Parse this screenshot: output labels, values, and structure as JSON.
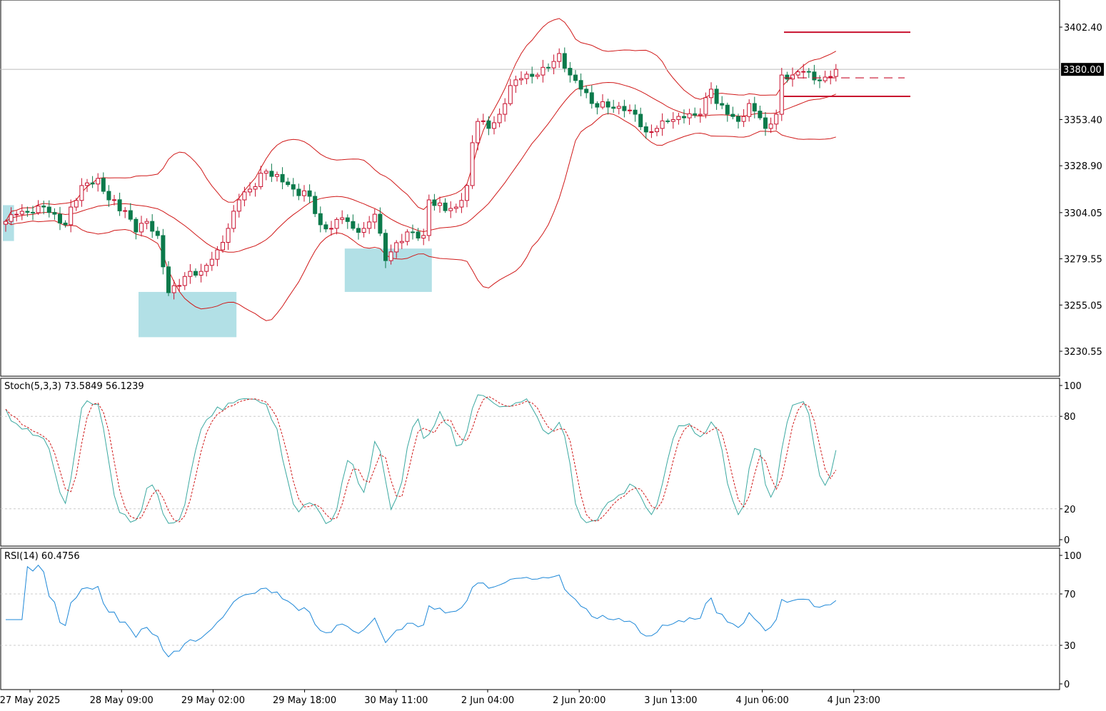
{
  "chart_data": {
    "type": "candlestick",
    "symbol_timeframe": "H1",
    "bars": 154,
    "close_path": [
      [
        0,
        3299.4
      ],
      [
        2,
        3303.2
      ],
      [
        5,
        3304.0
      ],
      [
        7,
        3307.0
      ],
      [
        9,
        3303.2
      ],
      [
        11,
        3297.6
      ],
      [
        12,
        3307.0
      ],
      [
        14,
        3318.4
      ],
      [
        17,
        3322.2
      ],
      [
        19,
        3310.8
      ],
      [
        22,
        3305.1
      ],
      [
        24,
        3293.8
      ],
      [
        26,
        3299.4
      ],
      [
        28,
        3291.9
      ],
      [
        30,
        3261.6
      ],
      [
        32,
        3265.4
      ],
      [
        34,
        3272.9
      ],
      [
        36,
        3272.9
      ],
      [
        39,
        3284.3
      ],
      [
        41,
        3295.7
      ],
      [
        43,
        3310.8
      ],
      [
        45,
        3316.5
      ],
      [
        48,
        3326.0
      ],
      [
        51,
        3320.3
      ],
      [
        53,
        3316.5
      ],
      [
        56,
        3312.7
      ],
      [
        58,
        3297.6
      ],
      [
        60,
        3295.7
      ],
      [
        62,
        3301.3
      ],
      [
        64,
        3295.7
      ],
      [
        66,
        3295.7
      ],
      [
        68,
        3303.2
      ],
      [
        70,
        3278.6
      ],
      [
        72,
        3288.1
      ],
      [
        74,
        3293.8
      ],
      [
        77,
        3291.9
      ],
      [
        78,
        3310.8
      ],
      [
        81,
        3305.1
      ],
      [
        83,
        3307.0
      ],
      [
        85,
        3318.4
      ],
      [
        86,
        3341.1
      ],
      [
        87,
        3352.4
      ],
      [
        89,
        3348.7
      ],
      [
        91,
        3356.2
      ],
      [
        93,
        3371.4
      ],
      [
        95,
        3375.1
      ],
      [
        98,
        3377.0
      ],
      [
        100,
        3380.8
      ],
      [
        102,
        3388.4
      ],
      [
        104,
        3377.0
      ],
      [
        106,
        3369.5
      ],
      [
        108,
        3361.9
      ],
      [
        111,
        3360.0
      ],
      [
        114,
        3358.1
      ],
      [
        116,
        3356.2
      ],
      [
        118,
        3346.8
      ],
      [
        120,
        3348.7
      ],
      [
        122,
        3352.4
      ],
      [
        125,
        3354.3
      ],
      [
        128,
        3356.2
      ],
      [
        130,
        3369.5
      ],
      [
        131,
        3361.9
      ],
      [
        133,
        3356.2
      ],
      [
        135,
        3352.4
      ],
      [
        137,
        3361.9
      ],
      [
        139,
        3354.3
      ],
      [
        140,
        3348.7
      ],
      [
        142,
        3356.2
      ],
      [
        143,
        3377.0
      ],
      [
        145,
        3377.0
      ],
      [
        147,
        3378.9
      ],
      [
        149,
        3374.4
      ],
      [
        151,
        3375.9
      ],
      [
        153,
        3380.0
      ]
    ],
    "price_axis": {
      "ticks": [
        "3402.40",
        "3353.40",
        "3328.90",
        "3304.05",
        "3279.55",
        "3255.05",
        "3230.55"
      ],
      "range": [
        3225,
        3415
      ],
      "current_price": "3380.00"
    },
    "levels": [
      3399.7,
      3375.5,
      3365.7
    ],
    "zones": [
      {
        "from_bar": 0,
        "to_bar": 1,
        "low": 3289,
        "high": 3308
      },
      {
        "from_bar": 25,
        "to_bar": 42,
        "low": 3238,
        "high": 3262
      },
      {
        "from_bar": 63,
        "to_bar": 78,
        "low": 3262,
        "high": 3285
      }
    ],
    "time_axis": [
      "27 May 2025",
      "28 May 09:00",
      "29 May 02:00",
      "29 May 18:00",
      "30 May 11:00",
      "2 Jun 04:00",
      "2 Jun 20:00",
      "3 Jun 13:00",
      "4 Jun 06:00",
      "4 Jun 23:00"
    ],
    "bollinger": {
      "period": 20,
      "deviation": 2
    },
    "stochastic": {
      "label": "Stoch(5,3,3) 73.5849 56.1239",
      "ticks": [
        "100",
        "80",
        "20",
        "0"
      ],
      "levels": [
        80,
        20
      ]
    },
    "rsi": {
      "label": "RSI(14) 60.4756",
      "ticks": [
        "100",
        "70",
        "30",
        "0"
      ],
      "levels": [
        70,
        30
      ]
    }
  },
  "colors": {
    "bull_body": "#ffffff",
    "bull_line": "#c8102e",
    "bear": "#0b7a4b",
    "bands": "#d01818",
    "level": "#c8102e",
    "zone": "#b2e0e6",
    "stoch_main": "#3aa8a0",
    "stoch_signal": "#d01818",
    "rsi": "#1e88d8"
  }
}
